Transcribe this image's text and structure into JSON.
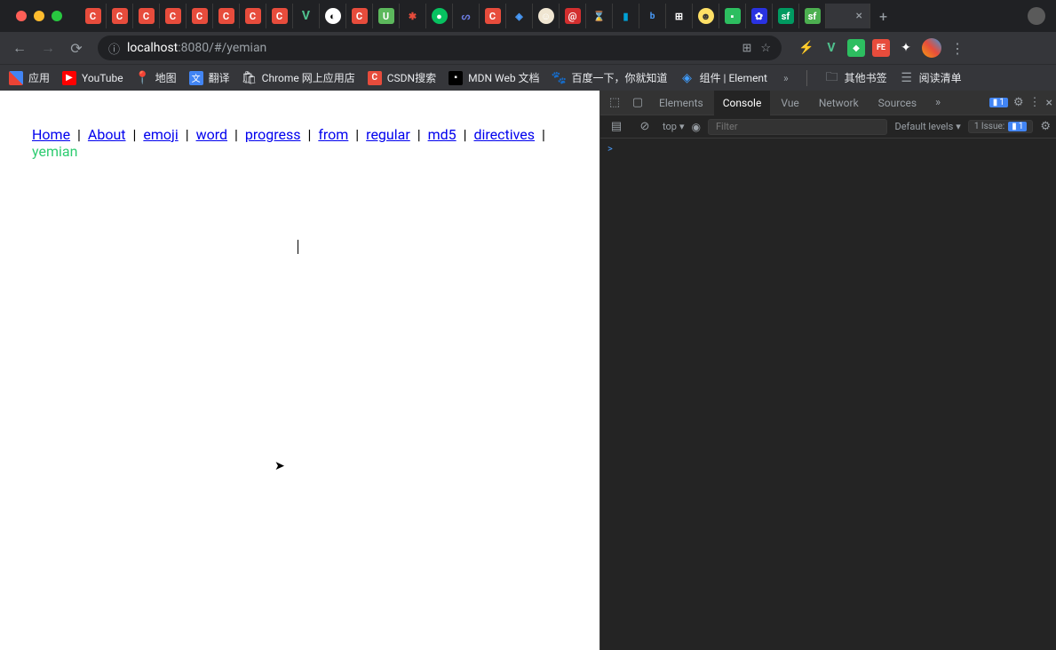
{
  "omnibox": {
    "host": "localhost",
    "path": ":8080/#/yemian"
  },
  "bookmarks": {
    "apps": "应用",
    "youtube": "YouTube",
    "map": "地图",
    "translate": "翻译",
    "chromestore": "Chrome 网上应用店",
    "csdn": "CSDN搜索",
    "mdn": "MDN Web 文档",
    "baidu": "百度一下，你就知道",
    "element": "组件 | Element",
    "more": "»",
    "other": "其他书签",
    "readlist": "阅读清单"
  },
  "nav": {
    "items": [
      {
        "label": "Home",
        "active": false
      },
      {
        "label": "About",
        "active": false
      },
      {
        "label": "emoji",
        "active": false
      },
      {
        "label": "word",
        "active": false
      },
      {
        "label": "progress",
        "active": false
      },
      {
        "label": "from",
        "active": false
      },
      {
        "label": "regular",
        "active": false
      },
      {
        "label": "md5",
        "active": false
      },
      {
        "label": "directives",
        "active": false
      },
      {
        "label": "yemian",
        "active": true
      }
    ],
    "separator": "|"
  },
  "devtools": {
    "tabs": {
      "elements": "Elements",
      "console": "Console",
      "vue": "Vue",
      "network": "Network",
      "sources": "Sources",
      "more": "»"
    },
    "badge1": "1",
    "filter": {
      "top": "top",
      "placeholder": "Filter",
      "levels": "Default levels",
      "issue_label": "1 Issue:",
      "issue_count": "1"
    },
    "prompt": ">"
  }
}
